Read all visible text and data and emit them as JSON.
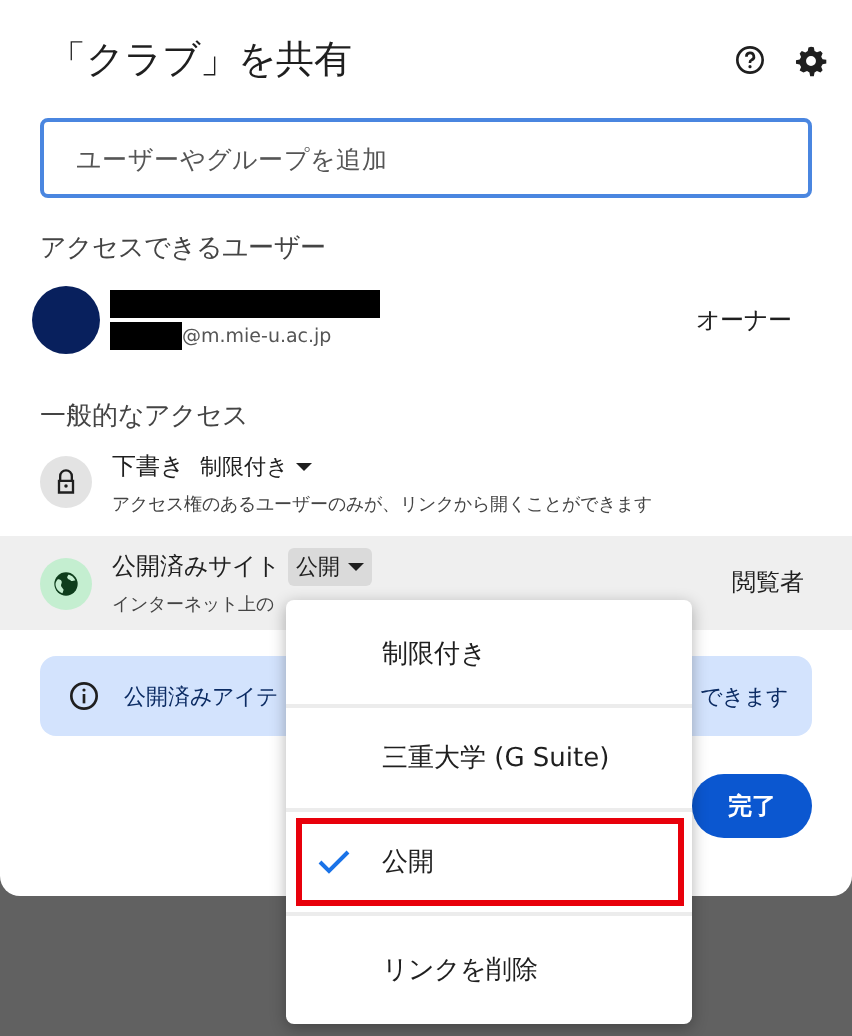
{
  "dialog": {
    "title": "「クラブ」を共有",
    "search": {
      "placeholder": "ユーザーやグループを追加"
    },
    "people_heading": "アクセスできるユーザー",
    "people": [
      {
        "email": "@m.mie-u.ac.jp",
        "role": "オーナー"
      }
    ],
    "general_heading": "一般的なアクセス",
    "access_rows": [
      {
        "kind": "lock",
        "label": "下書き",
        "setting": "制限付き",
        "description": "アクセス権のあるユーザーのみが、リンクから開くことができます",
        "selected": false
      },
      {
        "kind": "globe",
        "label": "公開済みサイト",
        "setting": "公開",
        "description": "インターネット上の",
        "role": "閲覧者",
        "selected": true
      }
    ],
    "banner": {
      "text_start": "公開済みアイテ",
      "text_end": "できます"
    },
    "done_button": "完了"
  },
  "menu": {
    "items": [
      {
        "label": "制限付き",
        "selected": false,
        "highlighted": false
      },
      {
        "label": "三重大学 (G Suite)",
        "selected": false,
        "highlighted": false
      },
      {
        "label": "公開",
        "selected": true,
        "highlighted": true
      },
      {
        "label": "リンクを削除",
        "selected": false,
        "highlighted": false
      }
    ]
  }
}
